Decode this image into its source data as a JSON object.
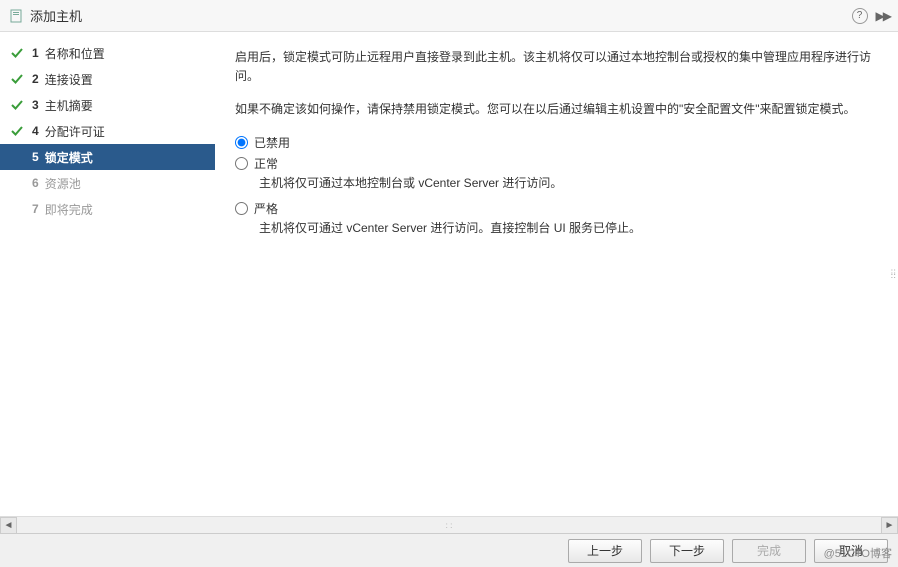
{
  "header": {
    "title": "添加主机"
  },
  "sidebar": {
    "steps": [
      {
        "num": "1",
        "label": "名称和位置",
        "state": "completed"
      },
      {
        "num": "2",
        "label": "连接设置",
        "state": "completed"
      },
      {
        "num": "3",
        "label": "主机摘要",
        "state": "completed"
      },
      {
        "num": "4",
        "label": "分配许可证",
        "state": "completed"
      },
      {
        "num": "5",
        "label": "锁定模式",
        "state": "active"
      },
      {
        "num": "6",
        "label": "资源池",
        "state": "pending"
      },
      {
        "num": "7",
        "label": "即将完成",
        "state": "pending"
      }
    ]
  },
  "content": {
    "para1": "启用后，锁定模式可防止远程用户直接登录到此主机。该主机将仅可以通过本地控制台或授权的集中管理应用程序进行访问。",
    "para2": "如果不确定该如何操作，请保持禁用锁定模式。您可以在以后通过编辑主机设置中的\"安全配置文件\"来配置锁定模式。",
    "options": [
      {
        "value": "disabled",
        "label": "已禁用",
        "desc": "",
        "checked": true
      },
      {
        "value": "normal",
        "label": "正常",
        "desc": "主机将仅可通过本地控制台或 vCenter Server 进行访问。",
        "checked": false
      },
      {
        "value": "strict",
        "label": "严格",
        "desc": "主机将仅可通过 vCenter Server 进行访问。直接控制台 UI 服务已停止。",
        "checked": false
      }
    ]
  },
  "footer": {
    "back": "上一步",
    "next": "下一步",
    "finish": "完成",
    "cancel": "取消"
  },
  "watermark": "@51CTO博客"
}
